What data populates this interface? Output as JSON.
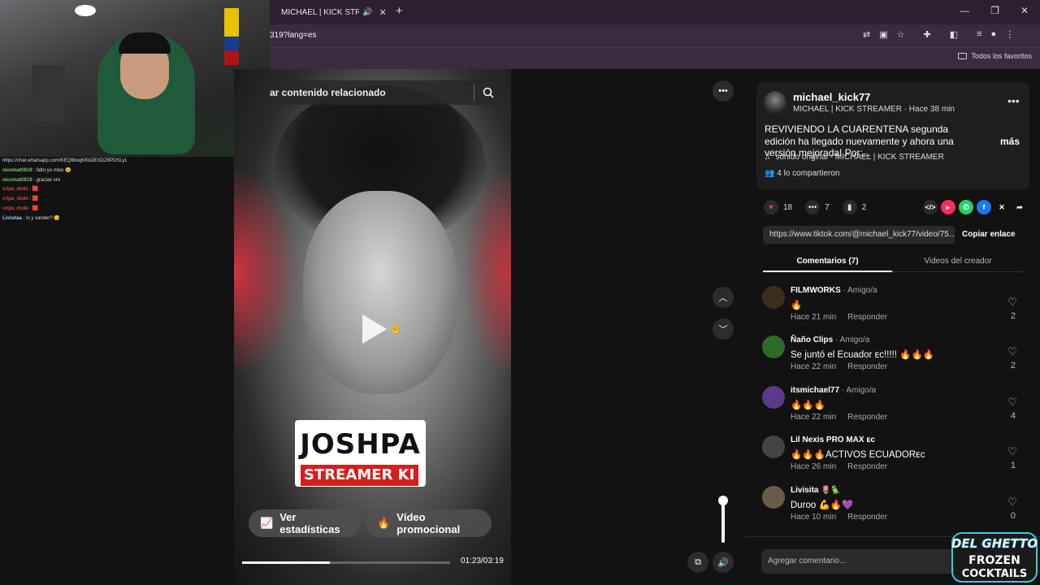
{
  "browser": {
    "tab_title": "MICHAEL | KICK STREAMER",
    "tab_close": "✕",
    "new_tab": "+",
    "url": "319?lang=es",
    "bookmarks_label": "Todos los favoritos"
  },
  "chat": [
    {
      "user": "https://chat.whatsapp.com/KEQ9boqKKkDEXDZ8PDSLyL",
      "msg": "",
      "cls": "m"
    },
    {
      "user": "nicomatti819",
      "msg": ": falto yo miso 😢",
      "cls": "u"
    },
    {
      "user": "nicomatti819",
      "msg": ": gracias vro",
      "cls": "u"
    },
    {
      "user": "cripa_dxde",
      "msg": ": 🟥",
      "cls": "u red"
    },
    {
      "user": "cripa_dxde",
      "msg": ": 🟥",
      "cls": "u red"
    },
    {
      "user": "cripa_dxde",
      "msg": ": 🟥",
      "cls": "u red"
    },
    {
      "user": "Livisitaa",
      "msg": ": Is y xander? 😊",
      "cls": "u blue"
    }
  ],
  "video": {
    "search_placeholder": "ar contenido relacionado",
    "title_big": "JOSHPA",
    "title_sub": "STREAMER KI",
    "btn_stats": "Ver estadísticas",
    "btn_promo": "Vídeo promocional",
    "time": "01:23/03:19",
    "progress": 0.42
  },
  "post": {
    "username": "michael_kick77",
    "subtitle": "MICHAEL | KICK STREAMER · Hace 38 min",
    "description": "REVIVIENDO LA CUARENTENA segunda edición ha llegado nuevamente y ahora una versión mejorada! Por:...",
    "more": "más",
    "sound": "sonido original - MICHAEL | KICK STREAMER",
    "shared": "4 lo compartieron",
    "likes": "18",
    "comments": "7",
    "saves": "2",
    "link": "https://www.tiktok.com/@michael_kick77/video/75...",
    "copy_link": "Copiar enlace"
  },
  "tabs": {
    "comments": "Comentarios (7)",
    "creator": "Videos del creador"
  },
  "comments": [
    {
      "name": "FILMWORKS",
      "tag": " · Amigo/a",
      "text": "🔥",
      "time": "Hace 21 min",
      "reply": "Responder",
      "likes": "2",
      "color": "#3a2f1a"
    },
    {
      "name": "Ñaño Clips",
      "tag": " · Amigo/a",
      "text": "Se juntó el Ecuador ᴇᴄ!!!!! 🔥🔥🔥",
      "time": "Hace 22 min",
      "reply": "Responder",
      "likes": "2",
      "color": "#2e6b2a"
    },
    {
      "name": "itsmichael77",
      "tag": " · Amigo/a",
      "text": "🔥🔥🔥",
      "time": "Hace 22 min",
      "reply": "Responder",
      "likes": "4",
      "color": "#5a3a8a"
    },
    {
      "name": "Lil Nexis PRO MAX ᴇᴄ",
      "tag": "",
      "text": "🔥🔥🔥ACTIVOS ECUADORᴇᴄ",
      "time": "Hace 26 min",
      "reply": "Responder",
      "likes": "1",
      "color": "#444"
    },
    {
      "name": "Livisita 🌷🦜",
      "tag": "",
      "text": "Duroo 💪🔥💜",
      "time": "Hace 10 min",
      "reply": "Responder",
      "likes": "0",
      "color": "#6a5a4a"
    }
  ],
  "add_comment_placeholder": "Agregar comentario...",
  "logo": {
    "line1": "DEL GHETTO",
    "line2": "FROZEN",
    "line3": "COCKTAILS"
  }
}
